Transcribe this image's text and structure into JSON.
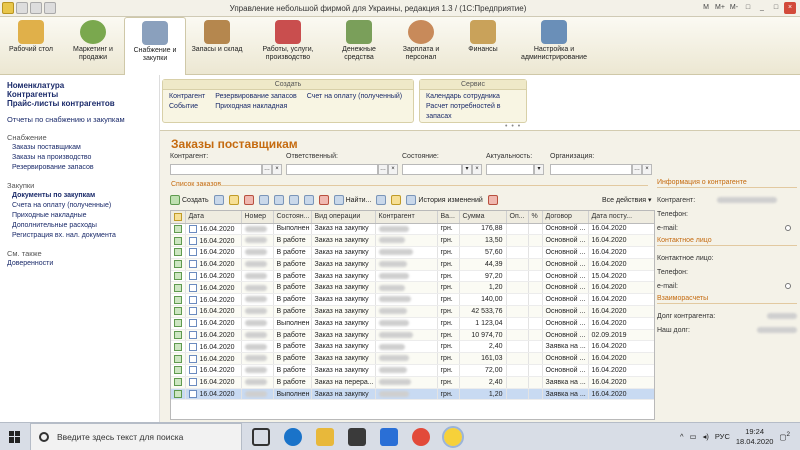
{
  "window": {
    "title": "Управление небольшой фирмой для Украины, редакция 1.3 /  (1С:Предприятие)",
    "controls": [
      "M",
      "M+",
      "M-",
      "□",
      "_",
      "□",
      "×"
    ]
  },
  "sections": [
    {
      "label": "Рабочий стол",
      "color": "#e0b04a"
    },
    {
      "label": "Маркетинг и продажи",
      "color": "#7aa84e"
    },
    {
      "label": "Снабжение и закупки",
      "color": "#8aa0bd"
    },
    {
      "label": "Запасы и склад",
      "color": "#b5874e"
    },
    {
      "label": "Работы, услуги, производство",
      "color": "#c94e4e"
    },
    {
      "label": "Денежные средства",
      "color": "#7a9f5a"
    },
    {
      "label": "Зарплата и персонал",
      "color": "#c88a5a"
    },
    {
      "label": "Финансы",
      "color": "#c9a25a"
    },
    {
      "label": "Настройка и администрирование",
      "color": "#6a8fb8"
    }
  ],
  "leftnav": {
    "top_links": [
      "Номенклатура",
      "Контрагенты",
      "Прайс-листы контрагентов"
    ],
    "reports": "Отчеты по снабжению и закупкам",
    "group1": "Снабжение",
    "group1_items": [
      "Заказы поставщикам",
      "Заказы на производство",
      "Резервирование запасов"
    ],
    "group2": "Закупки",
    "group2_items": [
      "Документы по закупкам",
      "Счета на оплату (полученные)",
      "Приходные накладные",
      "Дополнительные расходы",
      "Регистрация вх. нал. документа"
    ],
    "group3": "См. также",
    "group3_items": [
      "Доверенности"
    ]
  },
  "actions": {
    "create_title": "Создать",
    "create_col1": [
      "Контрагент",
      "Событие"
    ],
    "create_col2": [
      "Резервирование запасов",
      "Приходная накладная"
    ],
    "create_col3": [
      "Счет на оплату (полученный)"
    ],
    "service_title": "Сервис",
    "service_items": [
      "Календарь сотрудника",
      "Расчет потребностей в запасах"
    ]
  },
  "form": {
    "title": "Заказы поставщикам",
    "filters": {
      "counterparty": "Контрагент:",
      "responsible": "Ответственный:",
      "state": "Состояние:",
      "relevance": "Актуальность:",
      "organization": "Организация:"
    },
    "list_title": "Список заказов",
    "toolbar": {
      "create": "Создать",
      "find": "Найти...",
      "history": "История изменений",
      "all_actions": "Все действия"
    },
    "columns": [
      "",
      "Дата",
      "Номер",
      "Состоян...",
      "Вид операции",
      "Контрагент",
      "Ва...",
      "Сумма",
      "Оп...",
      "%",
      "Договор",
      "Дата посту..."
    ],
    "rows": [
      {
        "date": "16.04.2020",
        "state": "Выполнен",
        "op": "Заказ на закупку",
        "cur": "грн.",
        "sum": "176,88",
        "contract": "Основной ...",
        "due": "16.04.2020"
      },
      {
        "date": "16.04.2020",
        "state": "В работе",
        "op": "Заказ на закупку",
        "cur": "грн.",
        "sum": "13,50",
        "contract": "Основной ...",
        "due": "16.04.2020"
      },
      {
        "date": "16.04.2020",
        "state": "В работе",
        "op": "Заказ на закупку",
        "cur": "грн.",
        "sum": "57,60",
        "contract": "Основной ...",
        "due": "16.04.2020"
      },
      {
        "date": "16.04.2020",
        "state": "В работе",
        "op": "Заказ на закупку",
        "cur": "грн.",
        "sum": "44,39",
        "contract": "Основной ...",
        "due": "16.04.2020"
      },
      {
        "date": "16.04.2020",
        "state": "В работе",
        "op": "Заказ на закупку",
        "cur": "грн.",
        "sum": "97,20",
        "contract": "Основной ...",
        "due": "15.04.2020"
      },
      {
        "date": "16.04.2020",
        "state": "В работе",
        "op": "Заказ на закупку",
        "cur": "грн.",
        "sum": "1,20",
        "contract": "Основной ...",
        "due": "16.04.2020"
      },
      {
        "date": "16.04.2020",
        "state": "В работе",
        "op": "Заказ на закупку",
        "cur": "грн.",
        "sum": "140,00",
        "contract": "Основной ...",
        "due": "16.04.2020"
      },
      {
        "date": "16.04.2020",
        "state": "В работе",
        "op": "Заказ на закупку",
        "cur": "грн.",
        "sum": "42 533,76",
        "contract": "Основной ...",
        "due": "16.04.2020"
      },
      {
        "date": "16.04.2020",
        "state": "Выполнен",
        "op": "Заказ на закупку",
        "cur": "грн.",
        "sum": "1 123,04",
        "contract": "Основной ...",
        "due": "16.04.2020"
      },
      {
        "date": "16.04.2020",
        "state": "В работе",
        "op": "Заказ на закупку",
        "cur": "грн.",
        "sum": "10 974,70",
        "contract": "Основной ...",
        "due": "02.09.2019"
      },
      {
        "date": "16.04.2020",
        "state": "В работе",
        "op": "Заказ на закупку",
        "cur": "грн.",
        "sum": "2,40",
        "contract": "Заявка на ...",
        "due": "16.04.2020"
      },
      {
        "date": "16.04.2020",
        "state": "В работе",
        "op": "Заказ на закупку",
        "cur": "грн.",
        "sum": "161,03",
        "contract": "Основной ...",
        "due": "16.04.2020"
      },
      {
        "date": "16.04.2020",
        "state": "В работе",
        "op": "Заказ на закупку",
        "cur": "грн.",
        "sum": "72,00",
        "contract": "Основной ...",
        "due": "16.04.2020"
      },
      {
        "date": "16.04.2020",
        "state": "В работе",
        "op": "Заказ на перера...",
        "cur": "грн.",
        "sum": "2,40",
        "contract": "Заявка на ...",
        "due": "16.04.2020"
      },
      {
        "date": "16.04.2020",
        "state": "Выполнен",
        "op": "Заказ на закупку",
        "cur": "грн.",
        "sum": "1,20",
        "contract": "Заявка на ...",
        "due": "16.04.2020"
      }
    ],
    "selected_row": 14
  },
  "info": {
    "counterparty_section": "Информация о контрагенте",
    "counterparty": "Контрагент:",
    "phone": "Телефон:",
    "email": "e-mail:",
    "contact_section": "Контактное лицо",
    "contact": "Контактное лицо:",
    "phone2": "Телефон:",
    "email2": "e-mail:",
    "settlements_section": "Взаиморасчеты",
    "debt_counterparty": "Долг контрагента:",
    "our_debt": "Наш долг:"
  },
  "taskbar": {
    "search_placeholder": "Введите здесь текст для поиска",
    "lang": "РУС",
    "time": "19:24",
    "date": "18.04.2020",
    "notif_count": "2"
  }
}
